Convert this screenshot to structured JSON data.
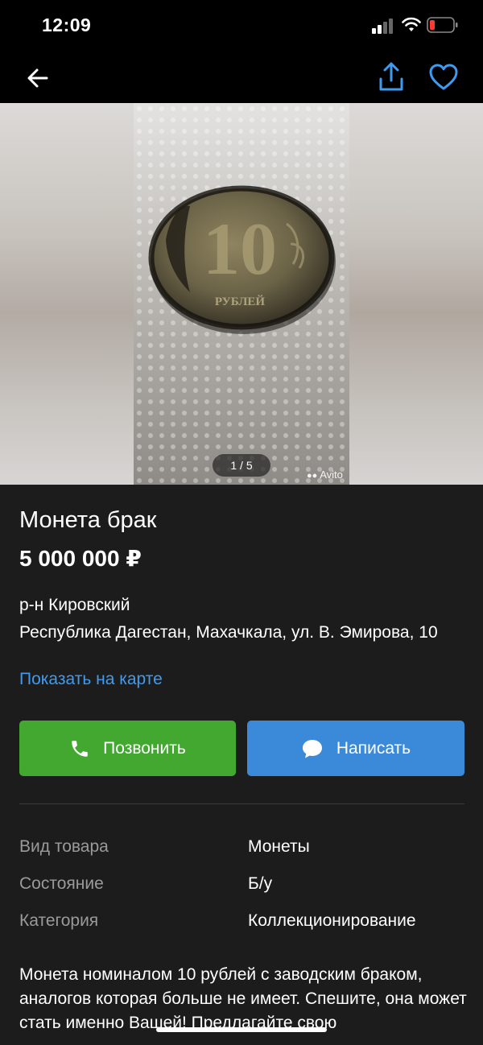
{
  "status": {
    "time": "12:09"
  },
  "gallery": {
    "counter": "1 / 5",
    "watermark": "Avito",
    "coin_text": "10",
    "coin_sub": "РУБЛЕЙ"
  },
  "listing": {
    "title": "Монета брак",
    "price": "5 000 000 ₽",
    "district": "р-н Кировский",
    "address": "Республика Дагестан, Махачкала, ул. В. Эмирова, 10",
    "map_link": "Показать на карте"
  },
  "actions": {
    "call_label": "Позвонить",
    "message_label": "Написать"
  },
  "params": [
    {
      "label": "Вид товара",
      "value": "Монеты"
    },
    {
      "label": "Состояние",
      "value": "Б/у"
    },
    {
      "label": "Категория",
      "value": "Коллекционирование"
    }
  ],
  "description": "Монета номиналом 10 рублей с заводским браком, аналогов которая больше не имеет. Спешите, она может стать именно Вашей! Предлагайте свою",
  "colors": {
    "link": "#3f9bf0",
    "call_button": "#43a82f",
    "message_button": "#3b8ad9",
    "background": "#1c1c1c"
  }
}
